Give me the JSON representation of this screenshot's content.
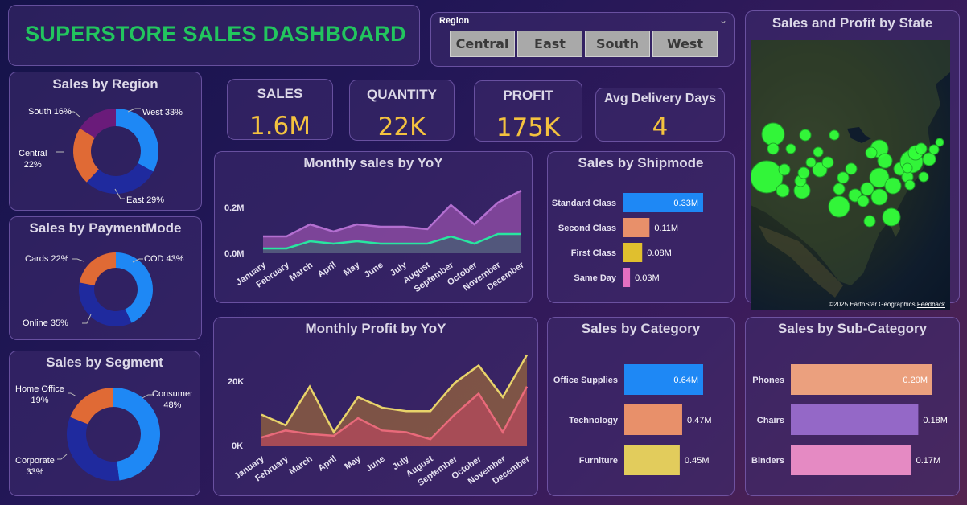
{
  "header": {
    "title": "SUPERSTORE SALES DASHBOARD"
  },
  "region_slicer": {
    "label": "Region",
    "options": [
      "Central",
      "East",
      "South",
      "West"
    ]
  },
  "kpis": [
    {
      "label": "SALES",
      "value": "1.6M"
    },
    {
      "label": "QUANTITY",
      "value": "22K"
    },
    {
      "label": "PROFIT",
      "value": "175K"
    },
    {
      "label": "Avg Delivery Days",
      "value": "4"
    }
  ],
  "colors": {
    "accent_green": "#22c55e",
    "kpi_value": "#f4c23f",
    "blue": "#1e88f5",
    "navy": "#1f2a9e",
    "orange": "#e06a35",
    "purple": "#6a1b7a",
    "salmon": "#e8906a",
    "gold": "#e0bf2e",
    "pink": "#e36fc1"
  },
  "sales_by_region": {
    "title": "Sales by Region",
    "labels": [
      "West 33%",
      "East 29%",
      "Central\n22%",
      "South 16%"
    ]
  },
  "sales_by_paymentmode": {
    "title": "Sales by PaymentMode",
    "labels": [
      "COD 43%",
      "Online 35%",
      "Cards 22%"
    ]
  },
  "sales_by_segment": {
    "title": "Sales by Segment",
    "labels": [
      "Consumer\n48%",
      "Corporate\n33%",
      "Home Office\n19%"
    ]
  },
  "monthly_sales": {
    "title": "Monthly sales by YoY",
    "y_ticks": [
      "0.2M",
      "0.0M"
    ],
    "months": [
      "January",
      "February",
      "March",
      "April",
      "May",
      "June",
      "July",
      "August",
      "September",
      "October",
      "November",
      "December"
    ]
  },
  "monthly_profit": {
    "title": "Monthly Profit by YoY",
    "y_ticks": [
      "20K",
      "0K"
    ],
    "months": [
      "January",
      "February",
      "March",
      "April",
      "May",
      "June",
      "July",
      "August",
      "September",
      "October",
      "November",
      "December"
    ]
  },
  "sales_by_shipmode": {
    "title": "Sales by Shipmode",
    "rows": [
      {
        "label": "Standard Class",
        "value": "0.33M"
      },
      {
        "label": "Second Class",
        "value": "0.11M"
      },
      {
        "label": "First Class",
        "value": "0.08M"
      },
      {
        "label": "Same Day",
        "value": "0.03M"
      }
    ]
  },
  "sales_by_category": {
    "title": "Sales by Category",
    "rows": [
      {
        "label": "Office Supplies",
        "value": "0.64M"
      },
      {
        "label": "Technology",
        "value": "0.47M"
      },
      {
        "label": "Furniture",
        "value": "0.45M"
      }
    ]
  },
  "sales_by_subcategory": {
    "title": "Sales by Sub-Category",
    "rows": [
      {
        "label": "Phones",
        "value": "0.20M"
      },
      {
        "label": "Chairs",
        "value": "0.18M"
      },
      {
        "label": "Binders",
        "value": "0.17M"
      }
    ]
  },
  "sales_profit_map": {
    "title": "Sales and Profit by State",
    "credit": "©2025 EarthStar Geographics",
    "feedback": "Feedback"
  },
  "chart_data": [
    {
      "type": "area",
      "title": "Monthly sales by YoY",
      "categories": [
        "January",
        "February",
        "March",
        "April",
        "May",
        "June",
        "July",
        "August",
        "September",
        "October",
        "November",
        "December"
      ],
      "series": [
        {
          "values": [
            0.07,
            0.07,
            0.12,
            0.09,
            0.12,
            0.11,
            0.11,
            0.1,
            0.2,
            0.12,
            0.21,
            0.26
          ]
        },
        {
          "values": [
            0.02,
            0.02,
            0.05,
            0.04,
            0.05,
            0.04,
            0.04,
            0.04,
            0.07,
            0.04,
            0.08,
            0.08
          ]
        }
      ],
      "ylim": [
        0,
        0.28
      ]
    },
    {
      "type": "area",
      "title": "Monthly Profit by YoY",
      "categories": [
        "January",
        "February",
        "March",
        "April",
        "May",
        "June",
        "July",
        "August",
        "September",
        "October",
        "November",
        "December"
      ],
      "series": [
        {
          "values": [
            9000,
            6000,
            17000,
            4000,
            14000,
            11000,
            10000,
            10000,
            18000,
            23000,
            14000,
            26000
          ]
        },
        {
          "values": [
            2500,
            4500,
            3500,
            3000,
            8000,
            4500,
            4000,
            2000,
            9000,
            15000,
            4000,
            17000
          ]
        }
      ],
      "ylim": [
        0,
        27000
      ]
    },
    {
      "type": "pie",
      "title": "Sales by Region",
      "categories": [
        "West",
        "East",
        "Central",
        "South"
      ],
      "values": [
        33,
        29,
        22,
        16
      ]
    },
    {
      "type": "pie",
      "title": "Sales by PaymentMode",
      "categories": [
        "COD",
        "Online",
        "Cards"
      ],
      "values": [
        43,
        35,
        22
      ]
    },
    {
      "type": "pie",
      "title": "Sales by Segment",
      "categories": [
        "Consumer",
        "Corporate",
        "Home Office"
      ],
      "values": [
        48,
        33,
        19
      ]
    },
    {
      "type": "bar",
      "title": "Sales by Shipmode",
      "categories": [
        "Standard Class",
        "Second Class",
        "First Class",
        "Same Day"
      ],
      "values": [
        0.33,
        0.11,
        0.08,
        0.03
      ]
    },
    {
      "type": "bar",
      "title": "Sales by Category",
      "categories": [
        "Office Supplies",
        "Technology",
        "Furniture"
      ],
      "values": [
        0.64,
        0.47,
        0.45
      ]
    },
    {
      "type": "bar",
      "title": "Sales by Sub-Category",
      "categories": [
        "Phones",
        "Chairs",
        "Binders"
      ],
      "values": [
        0.2,
        0.18,
        0.17
      ]
    }
  ]
}
